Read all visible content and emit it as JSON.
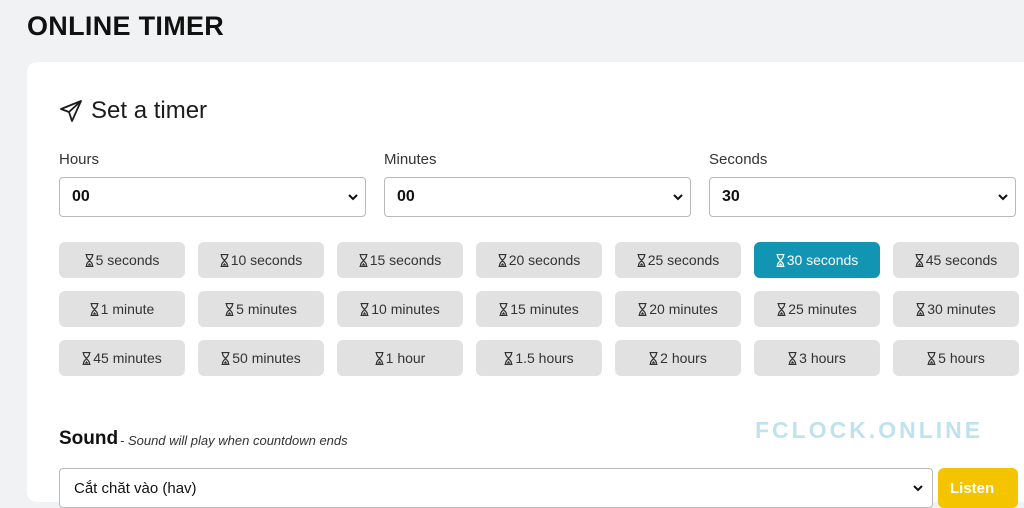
{
  "app_title": "ONLINE TIMER",
  "card_title": "Set a timer",
  "fields": [
    {
      "label": "Hours",
      "value": "00"
    },
    {
      "label": "Minutes",
      "value": "00"
    },
    {
      "label": "Seconds",
      "value": "30"
    }
  ],
  "presets": [
    {
      "label": "5 seconds",
      "active": false
    },
    {
      "label": "10 seconds",
      "active": false
    },
    {
      "label": "15 seconds",
      "active": false
    },
    {
      "label": "20 seconds",
      "active": false
    },
    {
      "label": "25 seconds",
      "active": false
    },
    {
      "label": "30 seconds",
      "active": true
    },
    {
      "label": "45 seconds",
      "active": false
    },
    {
      "label": "1 minute",
      "active": false
    },
    {
      "label": "5 minutes",
      "active": false
    },
    {
      "label": "10 minutes",
      "active": false
    },
    {
      "label": "15 minutes",
      "active": false
    },
    {
      "label": "20 minutes",
      "active": false
    },
    {
      "label": "25 minutes",
      "active": false
    },
    {
      "label": "30 minutes",
      "active": false
    },
    {
      "label": "45 minutes",
      "active": false
    },
    {
      "label": "50 minutes",
      "active": false
    },
    {
      "label": "1 hour",
      "active": false
    },
    {
      "label": "1.5 hours",
      "active": false
    },
    {
      "label": "2 hours",
      "active": false
    },
    {
      "label": "3 hours",
      "active": false
    },
    {
      "label": "5 hours",
      "active": false
    }
  ],
  "sound": {
    "title": "Sound",
    "subtitle": "- Sound will play when countdown ends",
    "selected": "Cắt chăt vào (hav)",
    "listen_label": "Listen"
  },
  "watermark": "FCLOCK.ONLINE",
  "colors": {
    "accent": "#1195b3",
    "preset_bg": "#e1e1e1",
    "listen_button": "#f5c400",
    "page_bg": "#f1f2f4"
  },
  "icons": {
    "title_icon": "paper-plane-icon",
    "preset_icon": "hourglass-icon",
    "select_icon": "chevron-down-icon"
  }
}
